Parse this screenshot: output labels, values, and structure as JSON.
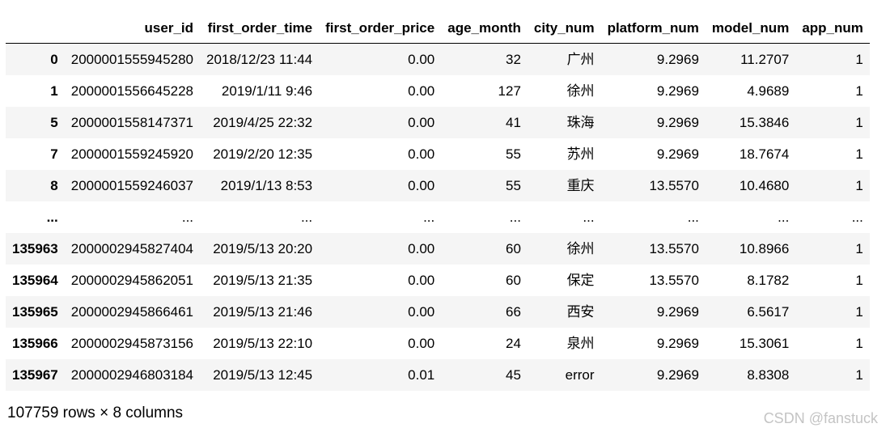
{
  "table": {
    "columns": [
      "",
      "user_id",
      "first_order_time",
      "first_order_price",
      "age_month",
      "city_num",
      "platform_num",
      "model_num",
      "app_num"
    ],
    "rows": [
      [
        "0",
        "2000001555945280",
        "2018/12/23 11:44",
        "0.00",
        "32",
        "广州",
        "9.2969",
        "11.2707",
        "1"
      ],
      [
        "1",
        "2000001556645228",
        "2019/1/11 9:46",
        "0.00",
        "127",
        "徐州",
        "9.2969",
        "4.9689",
        "1"
      ],
      [
        "5",
        "2000001558147371",
        "2019/4/25 22:32",
        "0.00",
        "41",
        "珠海",
        "9.2969",
        "15.3846",
        "1"
      ],
      [
        "7",
        "2000001559245920",
        "2019/2/20 12:35",
        "0.00",
        "55",
        "苏州",
        "9.2969",
        "18.7674",
        "1"
      ],
      [
        "8",
        "2000001559246037",
        "2019/1/13 8:53",
        "0.00",
        "55",
        "重庆",
        "13.5570",
        "10.4680",
        "1"
      ],
      [
        "...",
        "...",
        "...",
        "...",
        "...",
        "...",
        "...",
        "...",
        "..."
      ],
      [
        "135963",
        "2000002945827404",
        "2019/5/13 20:20",
        "0.00",
        "60",
        "徐州",
        "13.5570",
        "10.8966",
        "1"
      ],
      [
        "135964",
        "2000002945862051",
        "2019/5/13 21:35",
        "0.00",
        "60",
        "保定",
        "13.5570",
        "8.1782",
        "1"
      ],
      [
        "135965",
        "2000002945866461",
        "2019/5/13 21:46",
        "0.00",
        "66",
        "西安",
        "9.2969",
        "6.5617",
        "1"
      ],
      [
        "135966",
        "2000002945873156",
        "2019/5/13 22:10",
        "0.00",
        "24",
        "泉州",
        "9.2969",
        "15.3061",
        "1"
      ],
      [
        "135967",
        "2000002946803184",
        "2019/5/13 12:45",
        "0.01",
        "45",
        "error",
        "9.2969",
        "8.8308",
        "1"
      ]
    ]
  },
  "footer": {
    "dimensions": "107759 rows × 8 columns"
  },
  "watermark": "CSDN @fanstuck"
}
